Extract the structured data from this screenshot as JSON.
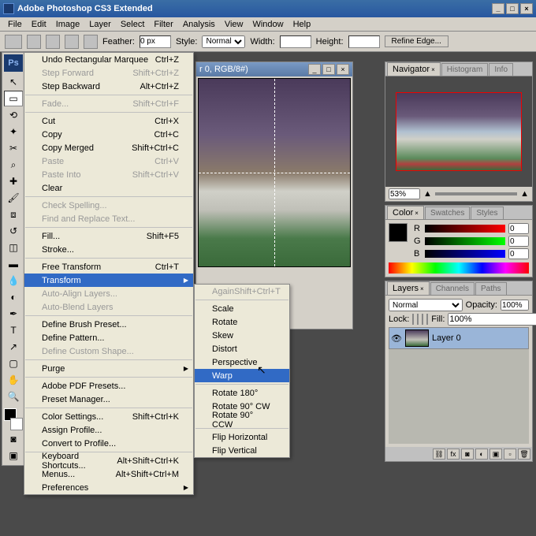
{
  "titlebar": {
    "title": "Adobe Photoshop CS3 Extended"
  },
  "menubar": [
    "File",
    "Edit",
    "Image",
    "Layer",
    "Select",
    "Filter",
    "Analysis",
    "View",
    "Window",
    "Help"
  ],
  "options": {
    "feather_label": "Feather:",
    "feather_val": "0 px",
    "style_label": "Style:",
    "style_val": "Normal",
    "width_label": "Width:",
    "height_label": "Height:",
    "refine": "Refine Edge..."
  },
  "doc_title": "r 0, RGB/8#)",
  "edit_menu": {
    "undo": "Undo Rectangular Marquee",
    "undo_sc": "Ctrl+Z",
    "step_fwd": "Step Forward",
    "step_fwd_sc": "Shift+Ctrl+Z",
    "step_bwd": "Step Backward",
    "step_bwd_sc": "Alt+Ctrl+Z",
    "fade": "Fade...",
    "fade_sc": "Shift+Ctrl+F",
    "cut": "Cut",
    "cut_sc": "Ctrl+X",
    "copy": "Copy",
    "copy_sc": "Ctrl+C",
    "copy_merged": "Copy Merged",
    "copy_merged_sc": "Shift+Ctrl+C",
    "paste": "Paste",
    "paste_sc": "Ctrl+V",
    "paste_into": "Paste Into",
    "paste_into_sc": "Shift+Ctrl+V",
    "clear": "Clear",
    "spell": "Check Spelling...",
    "findrep": "Find and Replace Text...",
    "fill": "Fill...",
    "fill_sc": "Shift+F5",
    "stroke": "Stroke...",
    "free_trans": "Free Transform",
    "free_trans_sc": "Ctrl+T",
    "transform": "Transform",
    "auto_align": "Auto-Align Layers...",
    "auto_blend": "Auto-Blend Layers",
    "brush_preset": "Define Brush Preset...",
    "pattern": "Define Pattern...",
    "custom_shape": "Define Custom Shape...",
    "purge": "Purge",
    "pdf_presets": "Adobe PDF Presets...",
    "preset_mgr": "Preset Manager...",
    "color_settings": "Color Settings...",
    "color_settings_sc": "Shift+Ctrl+K",
    "assign_profile": "Assign Profile...",
    "convert_profile": "Convert to Profile...",
    "kb_shortcuts": "Keyboard Shortcuts...",
    "kb_sc": "Alt+Shift+Ctrl+K",
    "menus": "Menus...",
    "menus_sc": "Alt+Shift+Ctrl+M",
    "prefs": "Preferences"
  },
  "submenu": {
    "again": "Again",
    "again_sc": "Shift+Ctrl+T",
    "scale": "Scale",
    "rotate": "Rotate",
    "skew": "Skew",
    "distort": "Distort",
    "perspective": "Perspective",
    "warp": "Warp",
    "rot180": "Rotate 180°",
    "rot90cw": "Rotate 90° CW",
    "rot90ccw": "Rotate 90° CCW",
    "fliph": "Flip Horizontal",
    "flipv": "Flip Vertical"
  },
  "navigator": {
    "tab1": "Navigator",
    "tab2": "Histogram",
    "tab3": "Info",
    "zoom": "53%"
  },
  "color": {
    "tab1": "Color",
    "tab2": "Swatches",
    "tab3": "Styles",
    "r_label": "R",
    "g_label": "G",
    "b_label": "B",
    "r_val": "0",
    "g_val": "0",
    "b_val": "0"
  },
  "layers": {
    "tab1": "Layers",
    "tab2": "Channels",
    "tab3": "Paths",
    "blend": "Normal",
    "opacity_label": "Opacity:",
    "opacity": "100%",
    "lock_label": "Lock:",
    "fill_label": "Fill:",
    "fill": "100%",
    "layer0": "Layer 0"
  }
}
